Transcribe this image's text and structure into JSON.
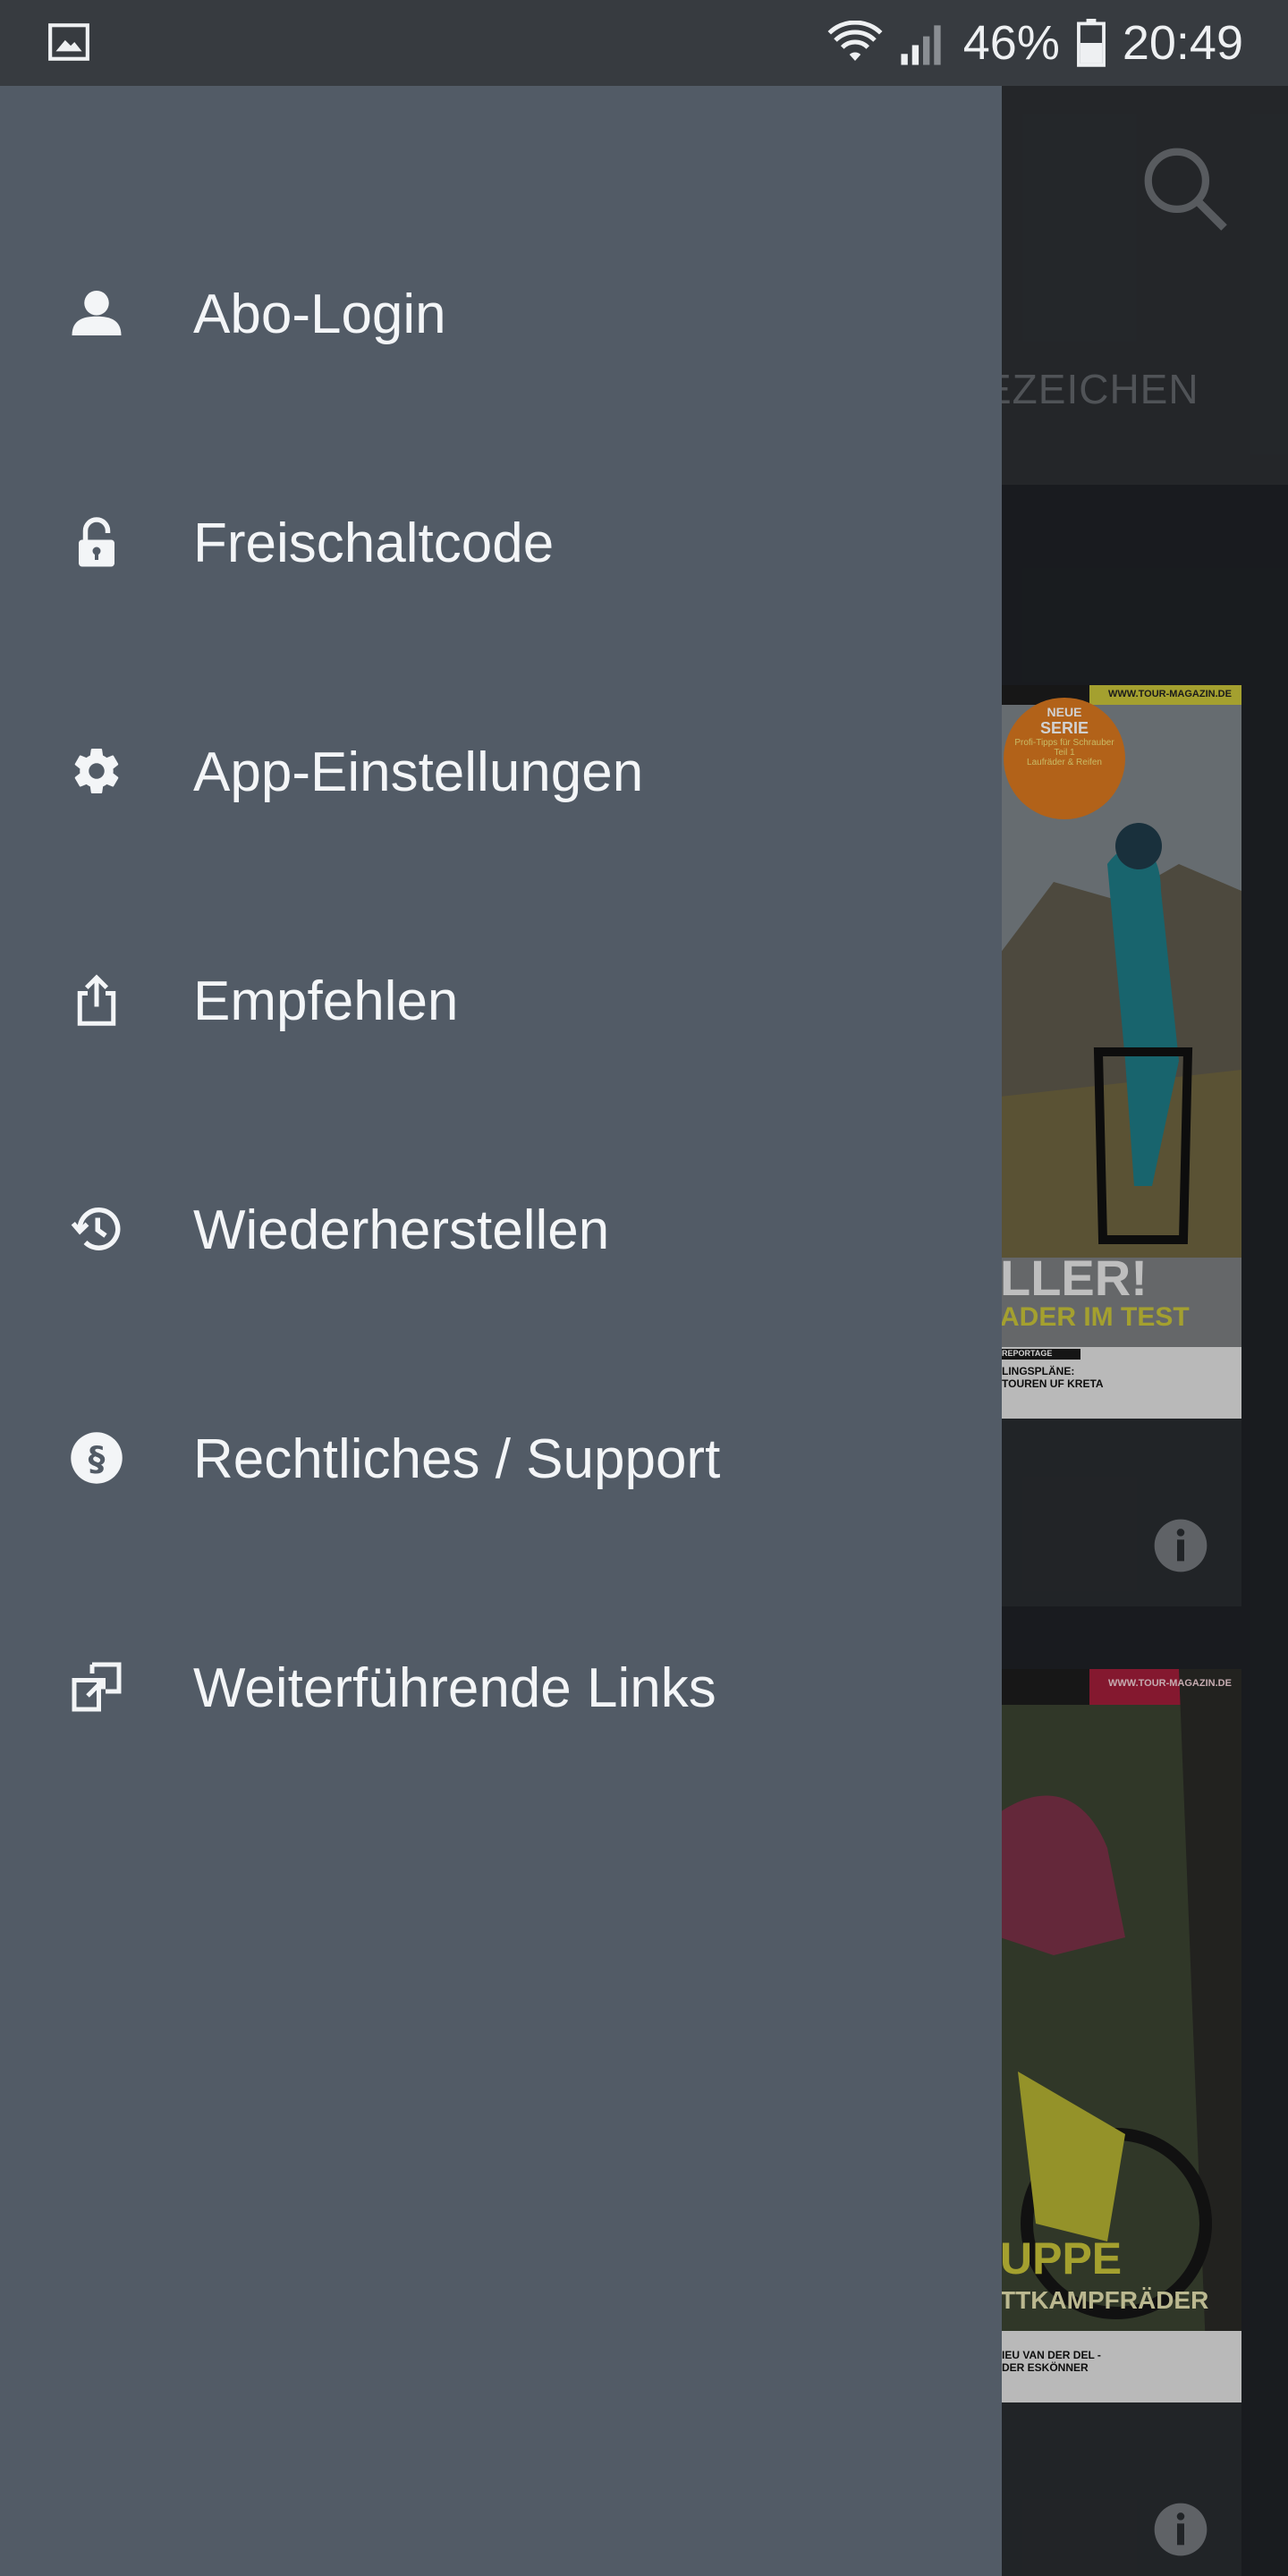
{
  "status_bar": {
    "battery": "46%",
    "time": "20:49",
    "icons": [
      "gallery-icon",
      "wifi-icon",
      "signal-icon",
      "battery-icon"
    ]
  },
  "background": {
    "tab_label": "EZEICHEN",
    "covers": [
      {
        "url": "WWW.TOUR-MAGAZIN.DE",
        "badge_line1": "NEUE",
        "badge_line2": "SERIE",
        "badge_sub": "Profi-Tipps für Schrauber",
        "badge_sub2": "Teil 1",
        "badge_sub3": "Laufräder & Reifen",
        "headline": "LLER!",
        "subheadline": "ADER IM TEST",
        "box_title": "REPORTAGE",
        "box_text": "LINGSPLÄNE: TOUREN UF KRETA"
      },
      {
        "url": "WWW.TOUR-MAGAZIN.DE",
        "headline": "UPPE",
        "subheadline": "TTKAMPFRÄDER",
        "box_text": "IEU VAN DER DEL - DER ESKÖNNER"
      }
    ]
  },
  "drawer": {
    "items": [
      {
        "label": "Abo-Login",
        "icon": "person-icon"
      },
      {
        "label": "Freischaltcode",
        "icon": "unlock-icon"
      },
      {
        "label": "App-Einstellungen",
        "icon": "gear-icon"
      },
      {
        "label": "Empfehlen",
        "icon": "share-icon"
      },
      {
        "label": "Wiederherstellen",
        "icon": "history-icon"
      },
      {
        "label": "Rechtliches / Support",
        "icon": "paragraph-icon"
      },
      {
        "label": "Weiterführende Links",
        "icon": "external-links-icon"
      }
    ]
  },
  "colors": {
    "drawer": "#525b66",
    "status_bar": "#373b40",
    "toolbar": "#2c2f33",
    "accent_yellow": "#c8c43a",
    "accent_orange": "#d9781f",
    "accent_red": "#a21e3a"
  }
}
